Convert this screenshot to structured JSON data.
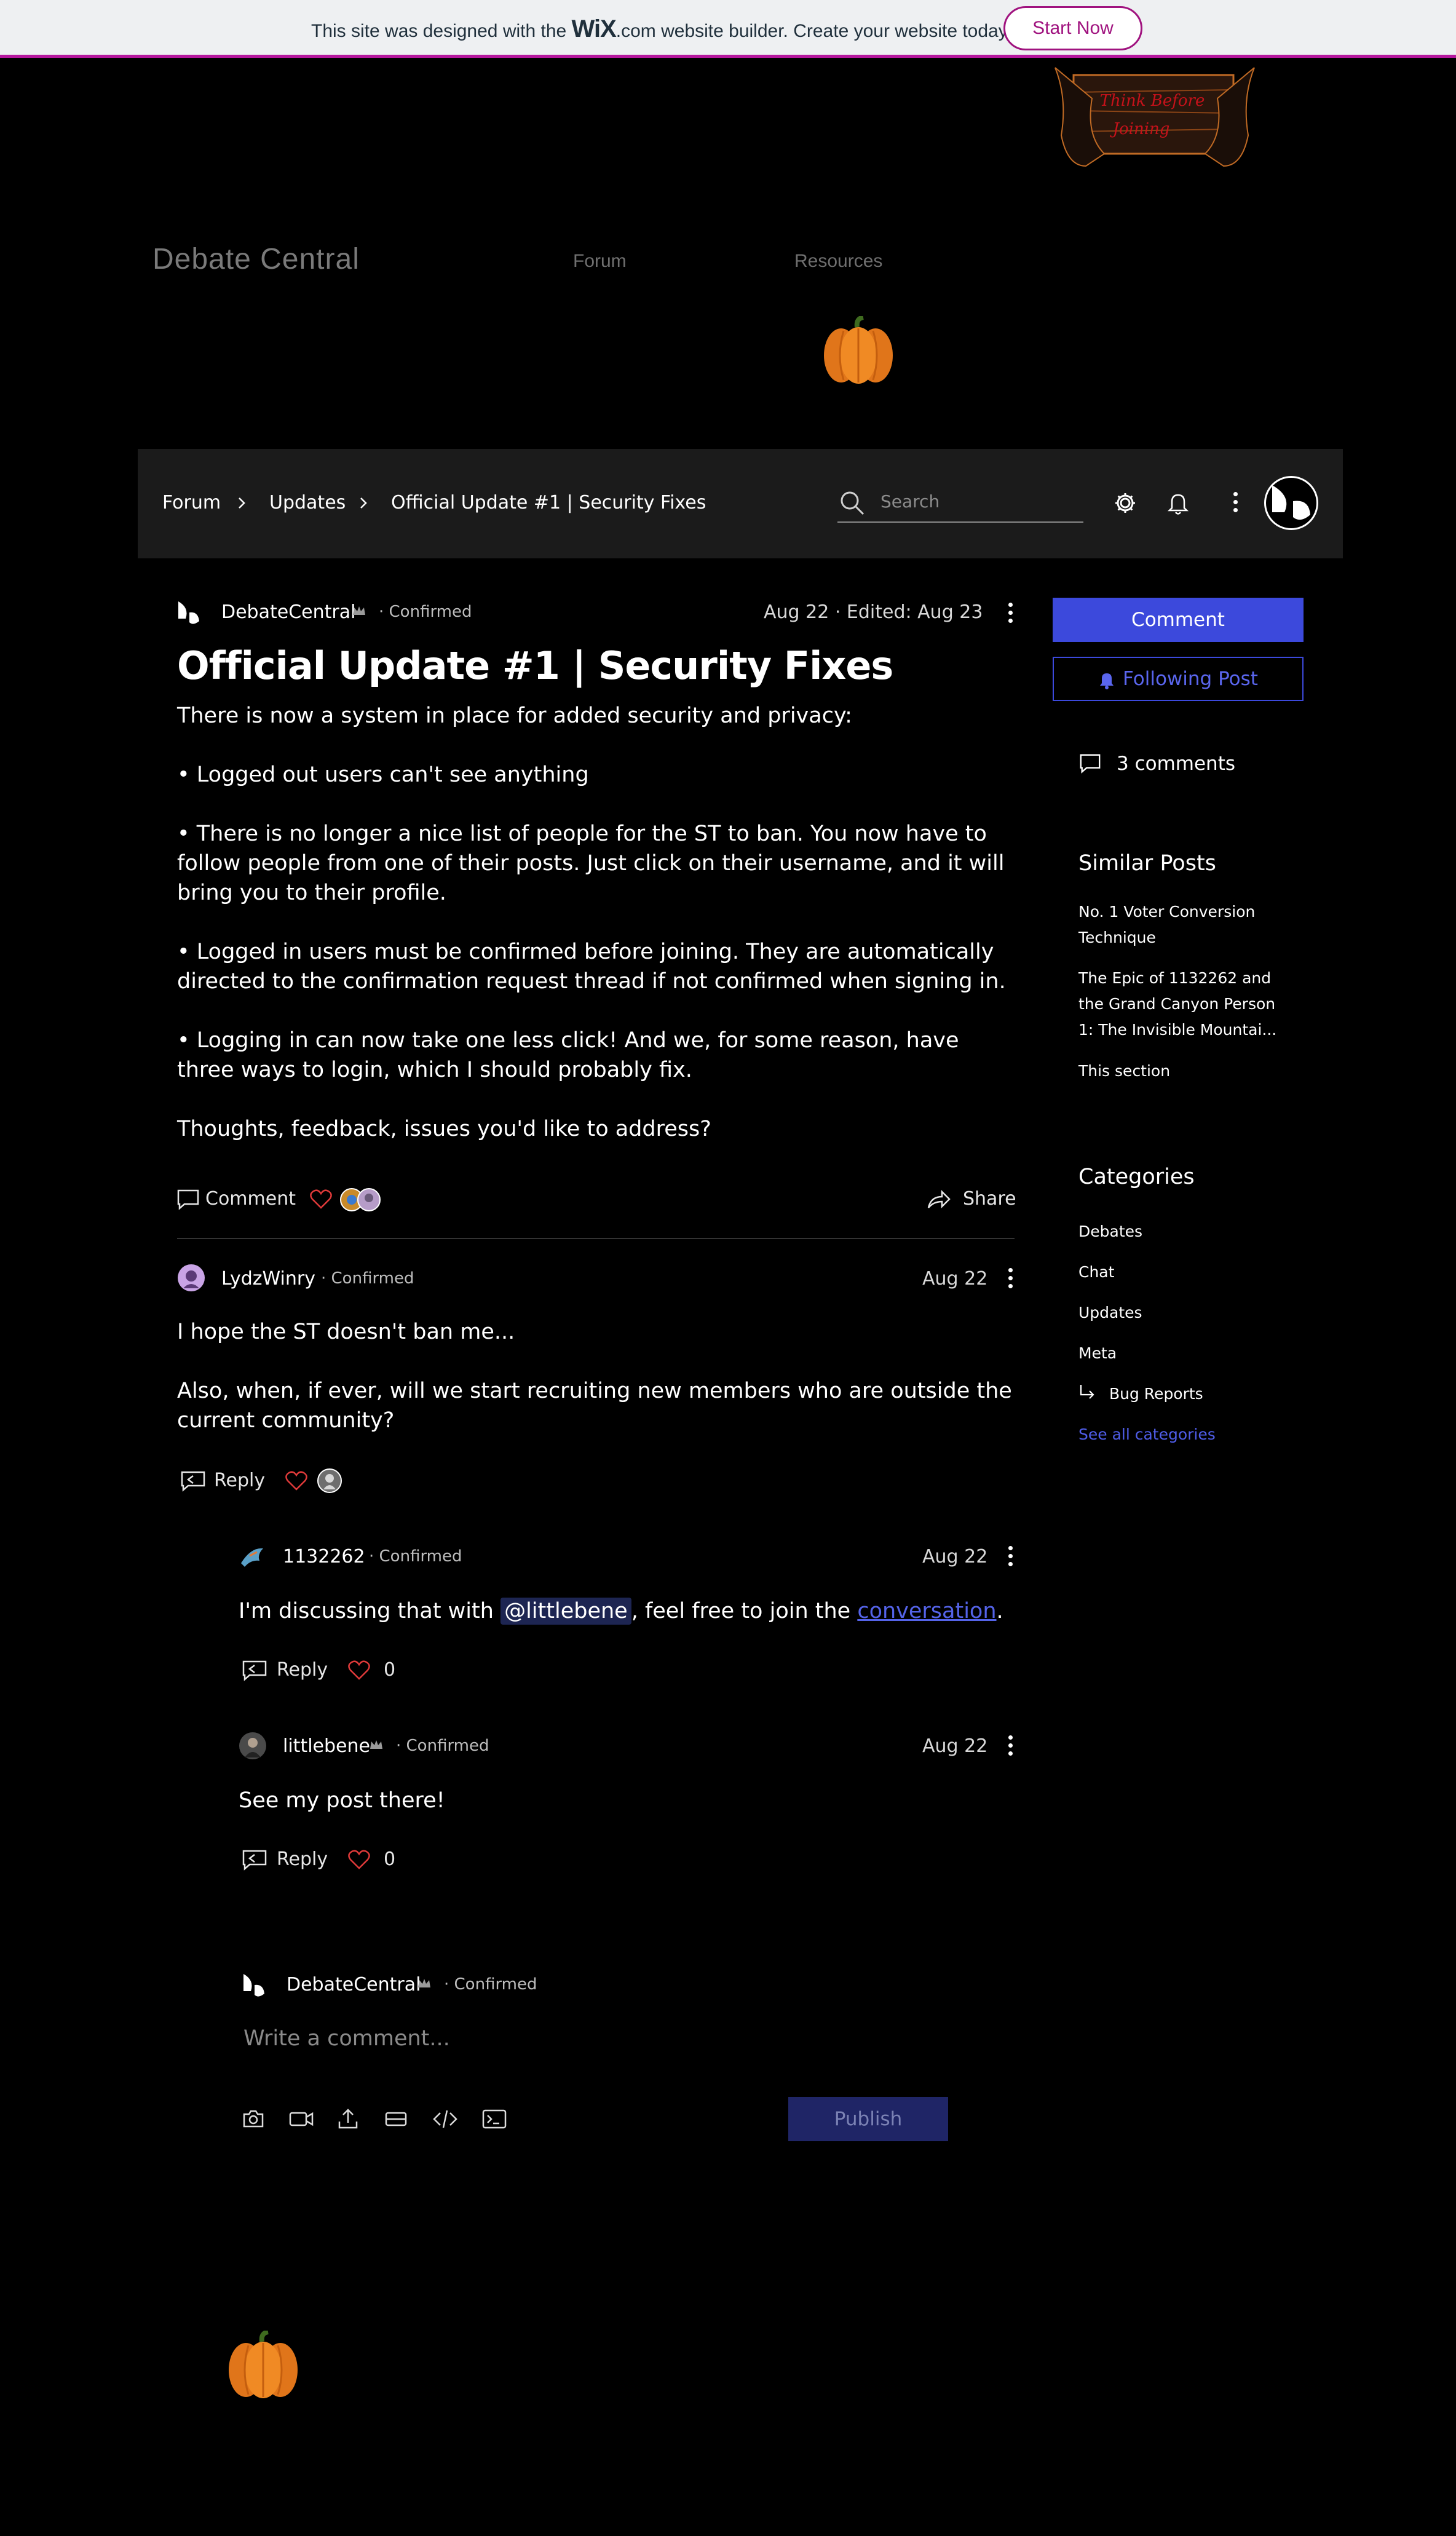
{
  "banner": {
    "text_before": "This site was designed with the ",
    "brand": "WiX",
    "text_after": ".com website builder. Create your website today.",
    "cta": "Start Now"
  },
  "header_art": {
    "text_line1": "Think Before",
    "text_line2": "Joining"
  },
  "site": {
    "title": "Debate Central",
    "nav": [
      "Forum",
      "Resources"
    ]
  },
  "forum_bar": {
    "breadcrumb": [
      "Forum",
      "Updates",
      "Official Update #1 | Security Fixes"
    ],
    "search_placeholder": "Search"
  },
  "post": {
    "author": "DebateCentral",
    "status": "Confirmed",
    "date": "Aug 22",
    "edited_label": "Edited:",
    "edited_date": "Aug 23",
    "title": "Official Update #1 | Security Fixes",
    "body": [
      "There is now a system in place for added security and privacy:",
      "• Logged out users can't see anything",
      "• There is no longer a nice list of people for the ST to ban. You now have to follow people from one of their posts. Just click on their username, and it will bring you to their profile.",
      "• Logged in users must be confirmed before joining. They are automatically directed to the confirmation request thread if not confirmed when signing in.",
      "• Logging in can now take one less click! And we, for some reason, have three ways to login, which I should probably fix.",
      "Thoughts, feedback, issues you'd like to address?"
    ],
    "comment_label": "Comment",
    "share_label": "Share"
  },
  "comments": [
    {
      "author": "LydzWinry",
      "status": "Confirmed",
      "date": "Aug 22",
      "text1": "I hope the ST doesn't ban me...",
      "text2": "Also, when, if ever, will we start recruiting new members who are outside the current community?",
      "reply_label": "Reply"
    }
  ],
  "replies": [
    {
      "author": "1132262",
      "status": "Confirmed",
      "date": "Aug 22",
      "text_before": "I'm discussing that with ",
      "mention": "@littlebene",
      "text_mid": ", feel free to join the ",
      "link": "conversation",
      "text_end": ".",
      "reply_label": "Reply",
      "likes": "0"
    },
    {
      "author": "littlebene",
      "status": "Confirmed",
      "date": "Aug 22",
      "text": "See my post there!",
      "reply_label": "Reply",
      "likes": "0"
    }
  ],
  "composer": {
    "author": "DebateCentral",
    "status": "Confirmed",
    "placeholder": "Write a comment...",
    "publish": "Publish"
  },
  "sidebar": {
    "comment_button": "Comment",
    "follow_button": "Following Post",
    "comments_count": "3 comments",
    "similar_heading": "Similar Posts",
    "similar": [
      "No. 1 Voter Conversion Technique",
      "The Epic of 1132262 and the Grand Canyon Person 1: The Invisible Mountai...",
      "This section"
    ],
    "categories_heading": "Categories",
    "categories": [
      "Debates",
      "Chat",
      "Updates",
      "Meta"
    ],
    "subcategory": "Bug Reports",
    "see_all": "See all categories"
  },
  "colors": {
    "accent": "#3c49dc",
    "wix_magenta": "#a0137f",
    "like_red": "#e03a3a"
  }
}
